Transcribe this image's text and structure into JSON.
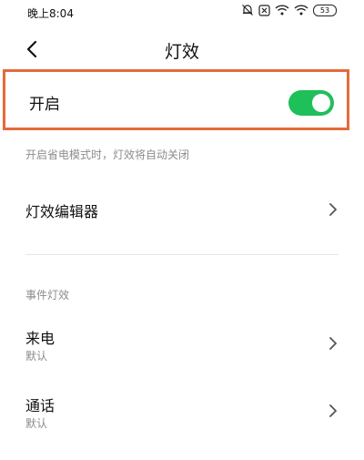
{
  "status_bar": {
    "time": "晚上8:04",
    "icons": [
      "alarm-off-icon",
      "sim-off-icon",
      "wifi-icon",
      "wifi-icon"
    ],
    "battery": "53"
  },
  "header": {
    "title": "灯效",
    "back_icon": "chevron-left-icon"
  },
  "toggle": {
    "label": "开启",
    "state": "on",
    "color": "#1fbf5a",
    "highlight_color": "#e46b3a"
  },
  "hint": "开启省电模式时，灯效将自动关闭",
  "editor": {
    "label": "灯效编辑器"
  },
  "event_section": {
    "header": "事件灯效",
    "items": [
      {
        "label": "来电",
        "sub": "默认"
      },
      {
        "label": "通话",
        "sub": "默认"
      }
    ]
  }
}
